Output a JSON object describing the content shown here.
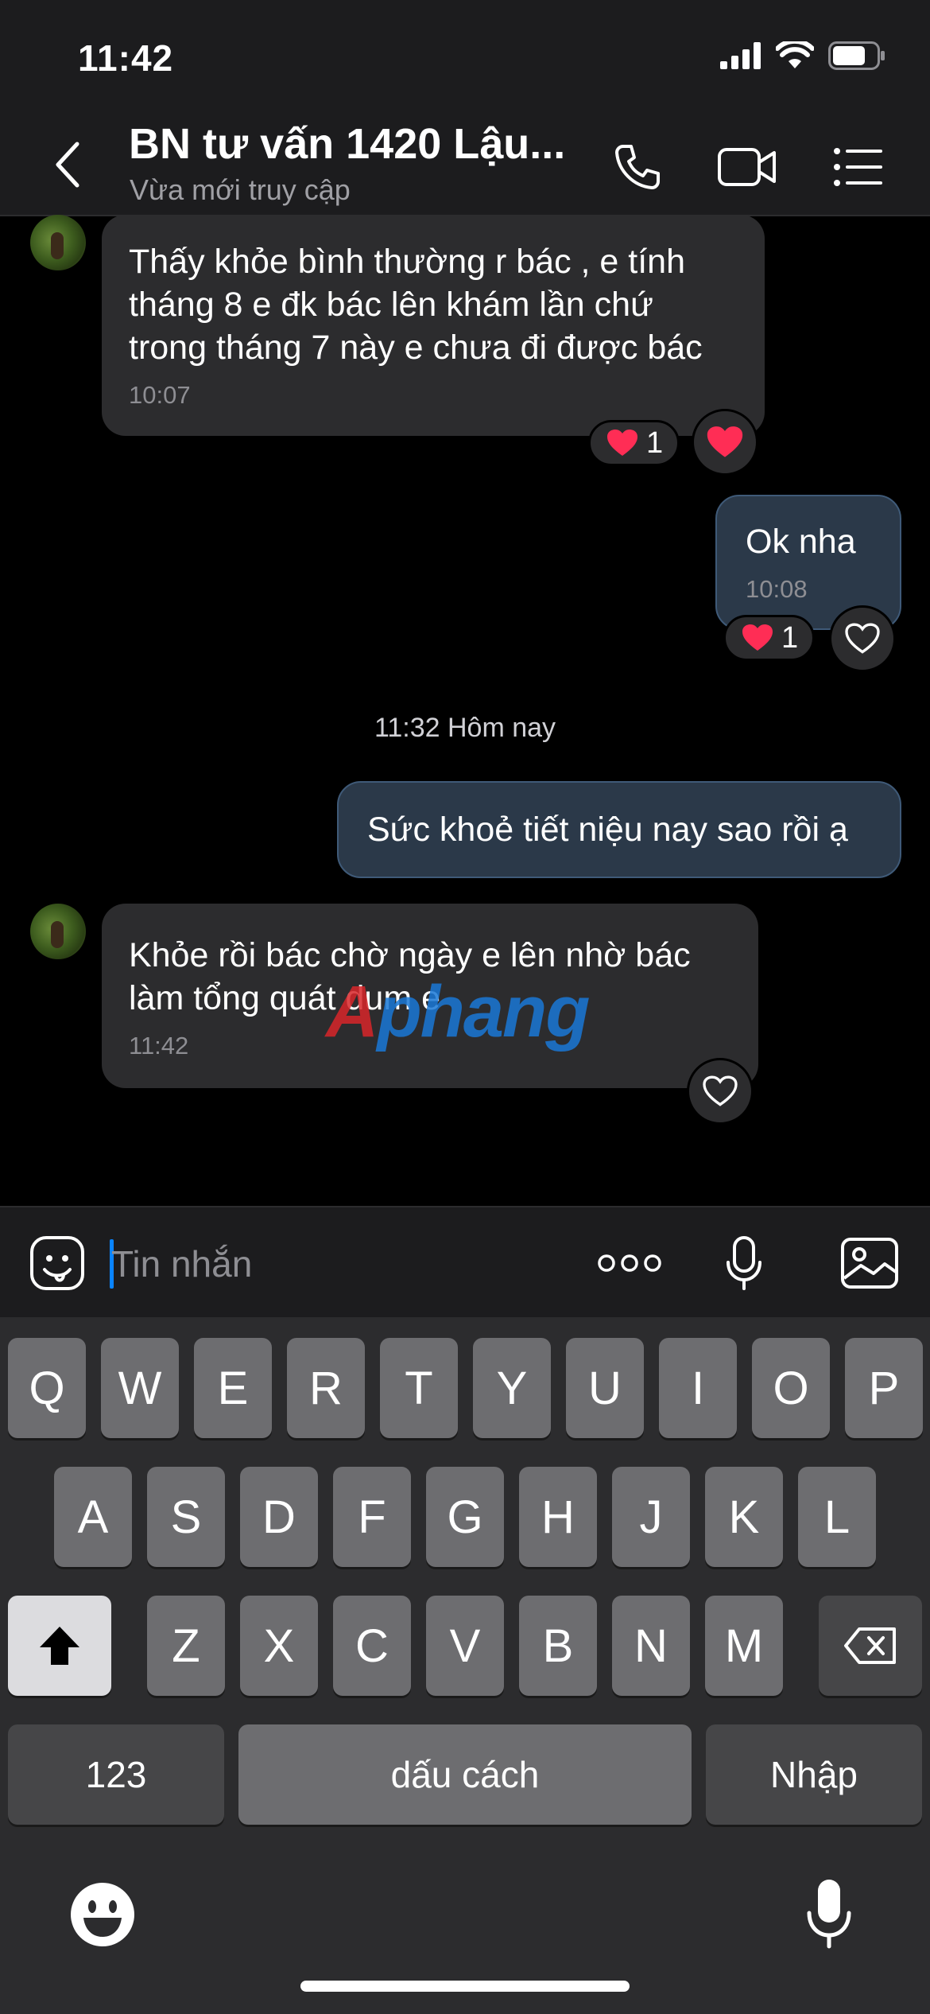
{
  "status_bar": {
    "time": "11:42"
  },
  "header": {
    "title": "BN tư vấn 1420 Lậu...",
    "subtitle": "Vừa mới truy cập"
  },
  "messages": [
    {
      "direction": "incoming",
      "text": "Thấy khỏe bình thường r bác  , e tính tháng 8 e đk bác lên khám lần chứ trong tháng 7 này e chưa đi được bác",
      "time": "10:07",
      "reaction_count": "1"
    },
    {
      "direction": "outgoing",
      "text": "Ok nha",
      "time": "10:08",
      "reaction_count": "1"
    },
    {
      "direction": "outgoing",
      "text": "Sức khoẻ tiết niệu nay sao rồi ạ"
    },
    {
      "direction": "incoming",
      "text": "Khỏe rồi bác chờ ngày e lên nhờ bác làm tổng quát dum e",
      "time": "11:42"
    }
  ],
  "day_separator": "11:32 Hôm nay",
  "watermark": {
    "part1": "A",
    "part2": "phang"
  },
  "input": {
    "placeholder": "Tin nhắn"
  },
  "keyboard": {
    "row1": [
      "Q",
      "W",
      "E",
      "R",
      "T",
      "Y",
      "U",
      "I",
      "O",
      "P"
    ],
    "row2": [
      "A",
      "S",
      "D",
      "F",
      "G",
      "H",
      "J",
      "K",
      "L"
    ],
    "row3": [
      "Z",
      "X",
      "C",
      "V",
      "B",
      "N",
      "M"
    ],
    "numbers_label": "123",
    "space_label": "dấu cách",
    "return_label": "Nhập"
  },
  "colors": {
    "accent": "#0a84ff",
    "heart": "#ff2d55",
    "incoming_bubble": "#2c2c2e",
    "outgoing_bubble": "#2b3949"
  },
  "icons": [
    "back-icon",
    "phone-icon",
    "video-icon",
    "menu-icon",
    "sticker-icon",
    "more-icon",
    "mic-icon",
    "gallery-icon",
    "shift-icon",
    "delete-icon",
    "emoji-icon",
    "dictation-icon",
    "heart-icon"
  ]
}
